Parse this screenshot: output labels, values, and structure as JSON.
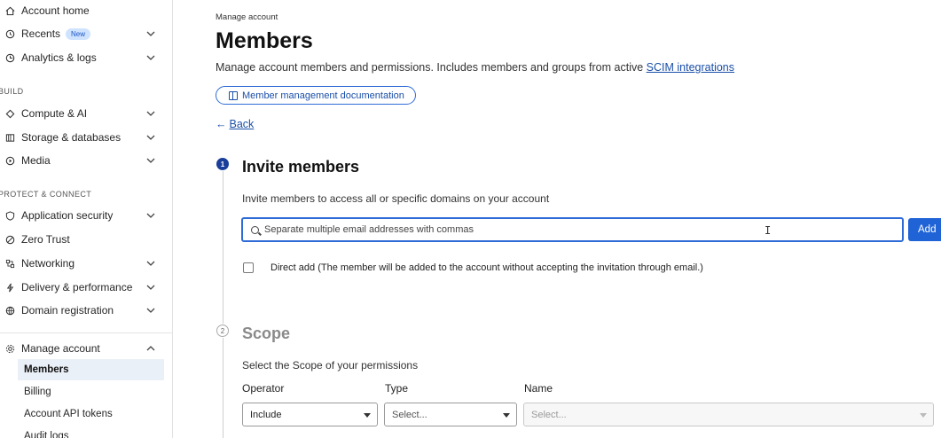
{
  "sidebar": {
    "items": [
      {
        "label": "Account home",
        "icon": "home-icon",
        "chevron": false
      },
      {
        "label": "Recents",
        "icon": "history-icon",
        "chevron": true,
        "badge": "New"
      },
      {
        "label": "Analytics & logs",
        "icon": "analytics-icon",
        "chevron": true
      }
    ],
    "section_build": "BUILD",
    "build_items": [
      {
        "label": "Compute & AI",
        "icon": "compute-icon",
        "chevron": true
      },
      {
        "label": "Storage & databases",
        "icon": "storage-icon",
        "chevron": true
      },
      {
        "label": "Media",
        "icon": "media-icon",
        "chevron": true
      }
    ],
    "section_protect": "PROTECT & CONNECT",
    "protect_items": [
      {
        "label": "Application security",
        "icon": "shield-icon",
        "chevron": true
      },
      {
        "label": "Zero Trust",
        "icon": "zero-trust-icon",
        "chevron": false
      },
      {
        "label": "Networking",
        "icon": "network-icon",
        "chevron": true
      },
      {
        "label": "Delivery & performance",
        "icon": "lightning-icon",
        "chevron": true
      },
      {
        "label": "Domain registration",
        "icon": "globe-icon",
        "chevron": true
      }
    ],
    "manage": {
      "label": "Manage account",
      "icon": "gear-icon"
    },
    "manage_sub": [
      "Members",
      "Billing",
      "Account API tokens",
      "Audit logs"
    ]
  },
  "main": {
    "eyebrow": "Manage account",
    "title": "Members",
    "description": "Manage account members and permissions. Includes members and groups from active ",
    "description_link": "SCIM integrations",
    "doc_button": "Member management documentation",
    "back": "Back",
    "step1": {
      "number": "1",
      "title": "Invite members",
      "subtitle": "Invite members to access all or specific domains on your account",
      "email_placeholder": "Separate multiple email addresses with commas",
      "add_label": "Add",
      "direct_add": "Direct add (The member will be added to the account without accepting the invitation through email.)"
    },
    "step2": {
      "number": "2",
      "title": "Scope",
      "subtitle": "Select the Scope of your permissions",
      "operator_label": "Operator",
      "type_label": "Type",
      "name_label": "Name",
      "operator_value": "Include",
      "type_value": "Select...",
      "name_value": "Select..."
    }
  },
  "colors": {
    "accent": "#1f63d6",
    "link": "#1a4fa8",
    "active_bg": "#eaf0f7"
  }
}
